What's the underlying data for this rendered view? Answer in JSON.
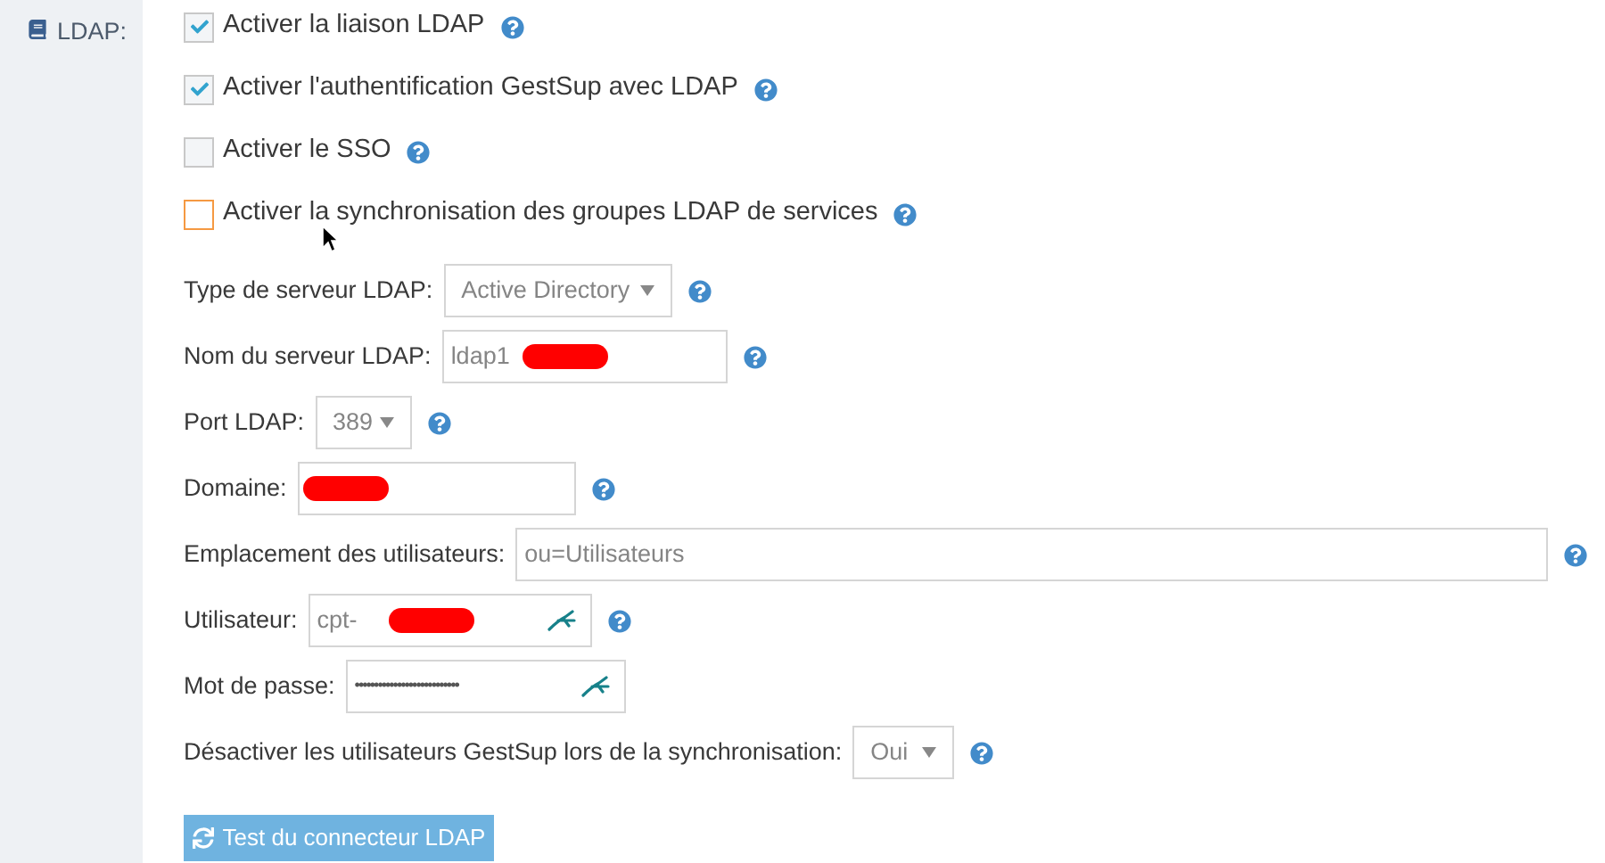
{
  "section": {
    "label": "LDAP:"
  },
  "checkboxes": [
    {
      "kind": "plain",
      "label": "Activer la liaison LDAP",
      "checked": true
    },
    {
      "kind": "plain",
      "label": "Activer l'authentification GestSup avec LDAP",
      "checked": true
    },
    {
      "kind": "plain",
      "label": "Activer le SSO",
      "checked": false
    },
    {
      "kind": "focused",
      "label": "Activer la synchronisation des groupes LDAP de services",
      "checked": false
    }
  ],
  "fields": [
    {
      "kind": "select",
      "label": "Type de serveur LDAP:",
      "value": "Active Directory"
    },
    {
      "kind": "input",
      "label": "Nom du serveur LDAP:",
      "value": "ldap1",
      "redacted": true,
      "autofill": false
    },
    {
      "kind": "select",
      "label": "Port LDAP:",
      "value": "389"
    },
    {
      "kind": "input",
      "label": "Domaine:",
      "redacted": true,
      "autofill": false
    },
    {
      "kind": "input",
      "label": "Emplacement des utilisateurs:",
      "value": "ou=Utilisateurs",
      "redacted": false,
      "autofill": false
    },
    {
      "kind": "input",
      "label": "Utilisateur:",
      "value": "cpt-",
      "redacted": true,
      "autofill": true
    },
    {
      "kind": "password",
      "label": "Mot de passe:",
      "value": "•••••••••••••••••••••••••••",
      "redacted": false,
      "autofill": true
    },
    {
      "kind": "select",
      "label": "Désactiver les utilisateurs GestSup lors de la synchronisation:",
      "value": "Oui"
    }
  ],
  "button": {
    "label": "Test du connecteur LDAP"
  }
}
